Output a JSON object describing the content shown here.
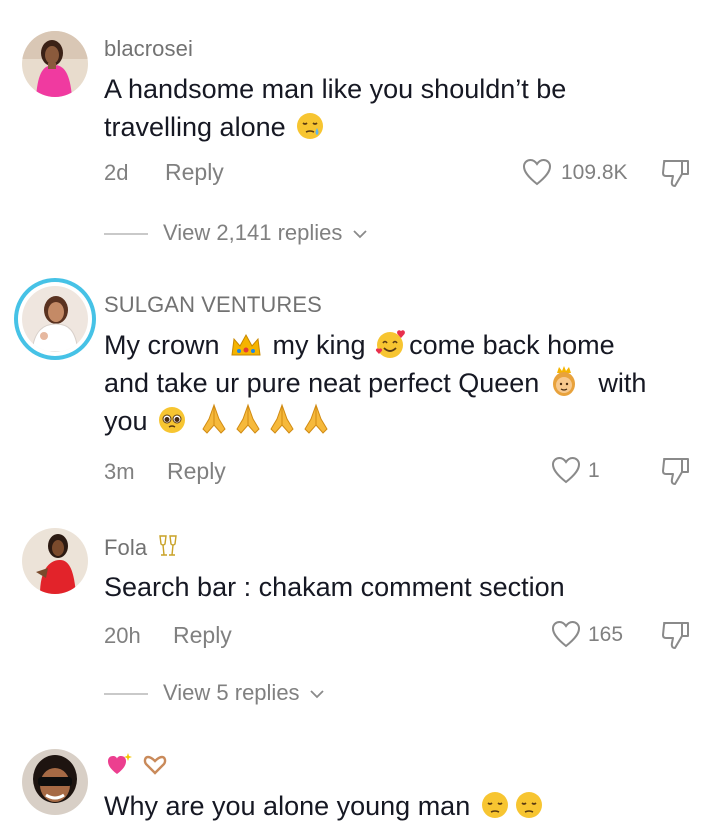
{
  "comments": [
    {
      "username": "blacrosei",
      "text_line1": "A handsome man like you shouldn’t be",
      "text_line2": "travelling alone",
      "time": "2d",
      "reply_label": "Reply",
      "likes": "109.8K",
      "view_replies": "View 2,141 replies",
      "avatar_color": "#f03aa0"
    },
    {
      "username": "SULGAN VENTURES",
      "text_seg1": "My crown",
      "text_seg2": "my king",
      "text_seg3": "come back home",
      "text_line2a": "and take ur pure neat perfect Queen",
      "text_line2b": "with",
      "text_line3": "you",
      "time": "3m",
      "reply_label": "Reply",
      "likes": "1",
      "ring_color": "#46c2e6"
    },
    {
      "username": "Fola",
      "text": "Search bar : chakam comment section",
      "time": "20h",
      "reply_label": "Reply",
      "likes": "165",
      "view_replies": "View 5 replies",
      "avatar_color": "#e2232a"
    },
    {
      "username_icons": [
        "sparkling-heart-icon",
        "heart-hands-icon"
      ],
      "text": "Why are you alone young man"
    }
  ],
  "icons": {
    "like": "heart-outline-icon",
    "dislike": "thumbs-down-icon",
    "chevron": "chevron-down-icon"
  }
}
